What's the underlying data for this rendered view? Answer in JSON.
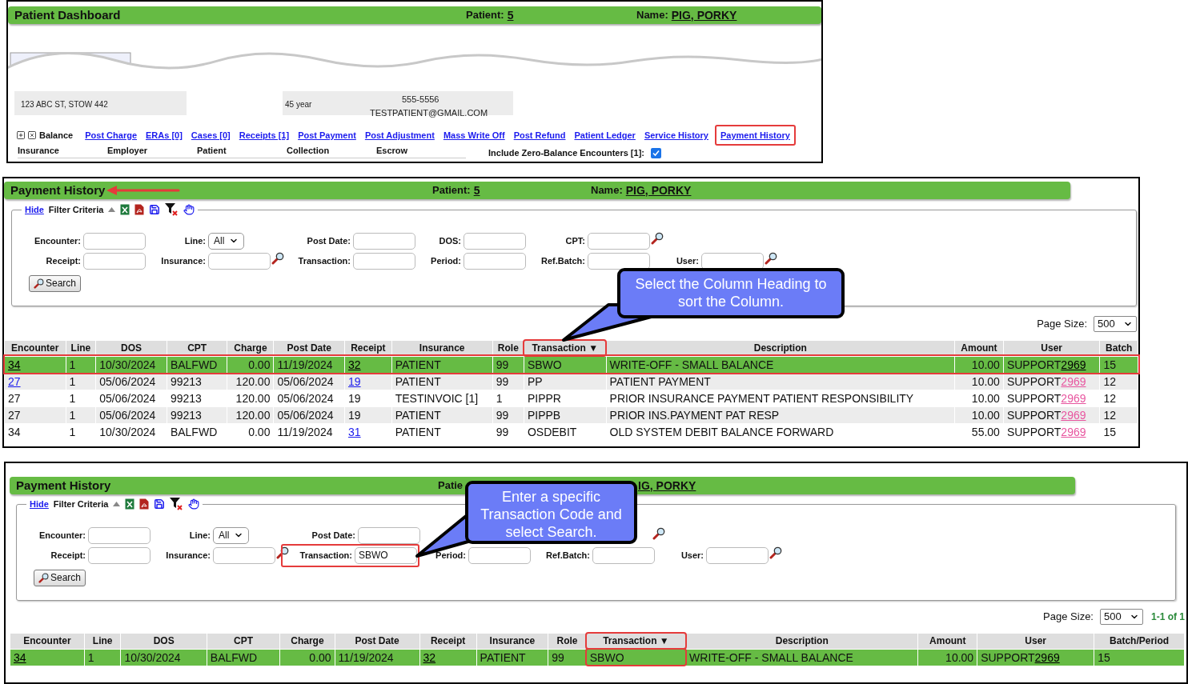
{
  "dashboard": {
    "title": "Patient Dashboard",
    "patient_label": "Patient:",
    "patient_value": "5",
    "name_label": "Name:",
    "name_value": "PIG, PORKY",
    "cards": [
      {
        "lines": [
          "123 ABC ST, STOW 442"
        ]
      },
      {
        "lines": [
          "45 year"
        ]
      },
      {
        "lines": [
          "555-5556",
          "TESTPATIENT@GMAIL.COM"
        ]
      }
    ],
    "balance_label": "Balance",
    "links": [
      {
        "label": "Post Charge",
        "highlighted": false
      },
      {
        "label": "ERAs [0]",
        "highlighted": false
      },
      {
        "label": "Cases [0]",
        "highlighted": false
      },
      {
        "label": "Receipts [1]",
        "highlighted": false
      },
      {
        "label": "Post Payment",
        "highlighted": false
      },
      {
        "label": "Post Adjustment",
        "highlighted": false
      },
      {
        "label": "Mass Write Off",
        "highlighted": false
      },
      {
        "label": "Post Refund",
        "highlighted": false
      },
      {
        "label": "Patient Ledger",
        "highlighted": false
      },
      {
        "label": "Service History",
        "highlighted": false
      },
      {
        "label": "Payment History",
        "highlighted": true
      }
    ],
    "tabs": [
      "Insurance",
      "Employer",
      "Patient",
      "Collection",
      "Escrow"
    ],
    "zero_balance": {
      "label": "Include Zero-Balance Encounters [1]:",
      "checked": true
    }
  },
  "panels": [
    {
      "title": "Payment History",
      "arrow": true,
      "patient_label": "Patient:",
      "patient_value": "5",
      "name_label": "Name:",
      "name_value": "PIG, PORKY",
      "filter": {
        "hide": "Hide",
        "title": "Filter Criteria",
        "search": "Search",
        "rows": [
          [
            {
              "label": "Encounter:",
              "kind": "text",
              "highlighted": false
            },
            {
              "label": "Line:",
              "kind": "select",
              "value": "All",
              "highlighted": false
            },
            {
              "label": "Post Date:",
              "kind": "text",
              "highlighted": false
            },
            {
              "label": "DOS:",
              "kind": "text",
              "highlighted": false
            },
            {
              "label": "CPT:",
              "kind": "lookup",
              "highlighted": false
            }
          ],
          [
            {
              "label": "Receipt:",
              "kind": "text",
              "highlighted": false
            },
            {
              "label": "Insurance:",
              "kind": "lookup",
              "highlighted": false
            },
            {
              "label": "Transaction:",
              "kind": "text",
              "highlighted": false
            },
            {
              "label": "Period:",
              "kind": "text",
              "highlighted": false
            },
            {
              "label": "Ref.Batch:",
              "kind": "text",
              "highlighted": false
            },
            {
              "label": "User:",
              "kind": "lookup",
              "highlighted": false
            }
          ]
        ]
      },
      "callout": "Select the Column Heading to sort the Column.",
      "page_size_label": "Page Size:",
      "page_size": "500",
      "table": {
        "columns": [
          {
            "label": "Encounter",
            "kind": "text"
          },
          {
            "label": "Line",
            "kind": "text"
          },
          {
            "label": "DOS",
            "kind": "text"
          },
          {
            "label": "CPT",
            "kind": "text"
          },
          {
            "label": "Charge",
            "kind": "amount"
          },
          {
            "label": "Post Date",
            "kind": "text"
          },
          {
            "label": "Receipt",
            "kind": "text"
          },
          {
            "label": "Insurance",
            "kind": "text"
          },
          {
            "label": "Role",
            "kind": "text"
          },
          {
            "label": "Transaction",
            "kind": "text",
            "sort": "▼",
            "highlighted": true
          },
          {
            "label": "Description",
            "kind": "text"
          },
          {
            "label": "Amount",
            "kind": "amount"
          },
          {
            "label": "User",
            "kind": "user"
          },
          {
            "label": "Batch",
            "kind": "text"
          }
        ],
        "rows": [
          {
            "selected": true,
            "highlighted": true,
            "cells": [
              {
                "link": "34"
              },
              "1",
              "10/30/2024",
              "BALFWD",
              "0.00",
              "11/19/2024",
              {
                "link": "32"
              },
              "PATIENT",
              "99",
              "SBWO",
              "WRITE-OFF - SMALL BALANCE",
              "10.00",
              {
                "text": "SUPPORT",
                "link": "2969"
              },
              "15"
            ]
          },
          {
            "selected": false,
            "highlighted": false,
            "cells": [
              {
                "link": "27"
              },
              "1",
              "05/06/2024",
              "99213",
              "120.00",
              "05/06/2024",
              {
                "link": "19"
              },
              "PATIENT",
              "99",
              "PP",
              "PATIENT PAYMENT",
              "10.00",
              {
                "text": "SUPPORT",
                "link": "2969"
              },
              "12"
            ]
          },
          {
            "selected": false,
            "highlighted": false,
            "cells": [
              "27",
              "1",
              "05/06/2024",
              "99213",
              "120.00",
              "05/06/2024",
              "19",
              "TESTINVOIC [1]",
              "1",
              "PIPPR",
              "PRIOR INSURANCE PAYMENT PATIENT RESPONSIBILITY",
              "10.00",
              {
                "text": "SUPPORT",
                "link": "2969"
              },
              "12"
            ]
          },
          {
            "selected": false,
            "highlighted": false,
            "cells": [
              "27",
              "1",
              "05/06/2024",
              "99213",
              "120.00",
              "05/06/2024",
              "19",
              "PATIENT",
              "99",
              "PIPPB",
              "PRIOR INS.PAYMENT PAT RESP",
              "10.00",
              {
                "text": "SUPPORT",
                "link": "2969"
              },
              "12"
            ]
          },
          {
            "selected": false,
            "highlighted": false,
            "cells": [
              "34",
              "1",
              "10/30/2024",
              "BALFWD",
              "0.00",
              "11/19/2024",
              {
                "link": "31"
              },
              "PATIENT",
              "99",
              "OSDEBIT",
              "OLD SYSTEM DEBIT BALANCE FORWARD",
              "55.00",
              {
                "text": "SUPPORT",
                "link": "2969"
              },
              "15"
            ]
          }
        ]
      }
    },
    {
      "title": "Payment History",
      "patient_label": "Patie",
      "name_value": "IG, PORKY",
      "filter": {
        "hide": "Hide",
        "title": "Filter Criteria",
        "search": "Search",
        "rows": [
          [
            {
              "label": "Encounter:",
              "kind": "text",
              "highlighted": false
            },
            {
              "label": "Line:",
              "kind": "select",
              "value": "All",
              "highlighted": false
            },
            {
              "label": "Post Date:",
              "kind": "text",
              "highlighted": false
            },
            {
              "kind": "covered"
            },
            {
              "kind": "covered_lookup"
            }
          ],
          [
            {
              "label": "Receipt:",
              "kind": "text",
              "highlighted": false
            },
            {
              "label": "Insurance:",
              "kind": "lookup",
              "highlighted": false
            },
            {
              "label": "Transaction:",
              "kind": "text",
              "value": "SBWO",
              "highlighted": true
            },
            {
              "label": "Period:",
              "kind": "text",
              "highlighted": false
            },
            {
              "label": "Ref.Batch:",
              "kind": "text",
              "highlighted": false
            },
            {
              "label": "User:",
              "kind": "lookup",
              "highlighted": false
            }
          ]
        ]
      },
      "callout": "Enter a specific Transaction Code and select Search.",
      "page_size_label": "Page Size:",
      "page_size": "500",
      "count": "1-1 of 1",
      "table": {
        "columns": [
          {
            "label": "Encounter",
            "kind": "text"
          },
          {
            "label": "Line",
            "kind": "text"
          },
          {
            "label": "DOS",
            "kind": "text"
          },
          {
            "label": "CPT",
            "kind": "text"
          },
          {
            "label": "Charge",
            "kind": "amount"
          },
          {
            "label": "Post Date",
            "kind": "text"
          },
          {
            "label": "Receipt",
            "kind": "text"
          },
          {
            "label": "Insurance",
            "kind": "text"
          },
          {
            "label": "Role",
            "kind": "text"
          },
          {
            "label": "Transaction",
            "kind": "text",
            "sort": "▼",
            "highlighted": true
          },
          {
            "label": "Description",
            "kind": "text"
          },
          {
            "label": "Amount",
            "kind": "amount"
          },
          {
            "label": "User",
            "kind": "user"
          },
          {
            "label": "Batch/Period",
            "kind": "text"
          }
        ],
        "rows": [
          {
            "selected": true,
            "highlighted": false,
            "cells": [
              {
                "link": "34"
              },
              "1",
              "10/30/2024",
              "BALFWD",
              "0.00",
              "11/19/2024",
              {
                "link": "32"
              },
              "PATIENT",
              "99",
              {
                "text": "SBWO",
                "highlighted": true
              },
              "WRITE-OFF - SMALL BALANCE",
              "10.00",
              {
                "text": "SUPPORT",
                "link": "2969"
              },
              "15"
            ]
          }
        ]
      }
    }
  ]
}
